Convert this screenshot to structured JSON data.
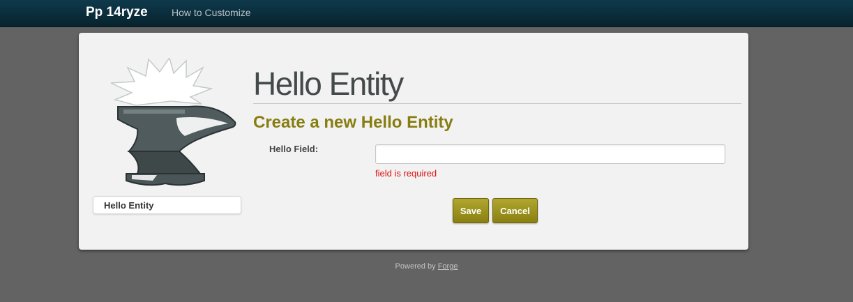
{
  "navbar": {
    "brand": "Pp 14ryze",
    "link": "How to Customize"
  },
  "sidebar": {
    "logo_icon": "anvil-icon",
    "items": [
      {
        "label": "Hello Entity"
      }
    ]
  },
  "main": {
    "title": "Hello Entity",
    "subtitle": "Create a new Hello Entity",
    "form": {
      "field_label": "Hello Field:",
      "field_value": "",
      "field_error": "field is required"
    },
    "buttons": {
      "save": "Save",
      "cancel": "Cancel"
    }
  },
  "footer": {
    "prefix": "Powered by",
    "link": "Forge"
  },
  "colors": {
    "navbar": "#0c3142",
    "page_background": "#636363",
    "card_background": "#f2f2f2",
    "accent": "#877d10",
    "button": "#9d9320",
    "error": "#dd1111"
  }
}
